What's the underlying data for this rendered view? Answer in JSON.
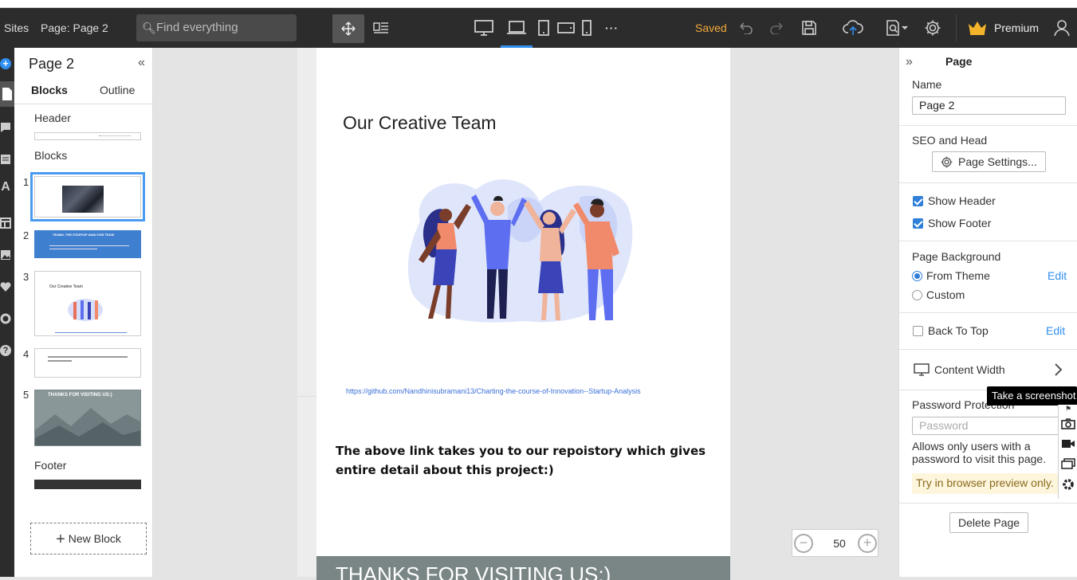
{
  "toolbar": {
    "sites_label": "Sites",
    "page_label": "Page: Page 2",
    "search_placeholder": "Find everything",
    "saved_label": "Saved",
    "premium_label": "Premium",
    "more_label": "···",
    "accent_color": "#2f8ef0",
    "saved_color": "#f2a93b"
  },
  "left_panel": {
    "title": "Page 2",
    "tabs": [
      {
        "label": "Blocks"
      },
      {
        "label": "Outline"
      }
    ],
    "header_label": "Header",
    "blocks_label": "Blocks",
    "footer_label": "Footer",
    "new_block_label": "New Block",
    "blocks": [
      {
        "num": "1"
      },
      {
        "num": "2",
        "text": "TEAM4: THE STARTUP ANALYSIS TEAM"
      },
      {
        "num": "3",
        "text": "Our Creative Team"
      },
      {
        "num": "4"
      },
      {
        "num": "5",
        "text": "THANKS FOR VISITING US:)"
      }
    ]
  },
  "page": {
    "title": "Our Creative Team",
    "link": "https://github.com/Nandhinisubramani13/Charting-the-course-of-Innovation--Startup-Analysis",
    "body_text": "The above link takes you to our repoistory which gives entire detail about this project:)",
    "footer_text": "THANKS FOR VISITING US:)"
  },
  "zoom": {
    "value": "50"
  },
  "right_panel": {
    "section_title": "Page",
    "name_label": "Name",
    "name_value": "Page 2",
    "seo_label": "SEO and Head",
    "page_settings_label": "Page Settings...",
    "show_header_label": "Show Header",
    "show_header_checked": true,
    "show_footer_label": "Show Footer",
    "show_footer_checked": true,
    "page_background_label": "Page Background",
    "from_theme_label": "From Theme",
    "custom_label": "Custom",
    "edit_label": "Edit",
    "back_to_top_label": "Back To Top",
    "back_to_top_checked": false,
    "content_width_label": "Content Width",
    "password_label": "Password Protection",
    "password_placeholder": "Password",
    "password_help": "Allows only users with a password to visit this page.",
    "try_hint": "Try in browser preview only.",
    "delete_label": "Delete Page"
  },
  "screenshot_tool": {
    "tooltip": "Take a screenshot"
  }
}
